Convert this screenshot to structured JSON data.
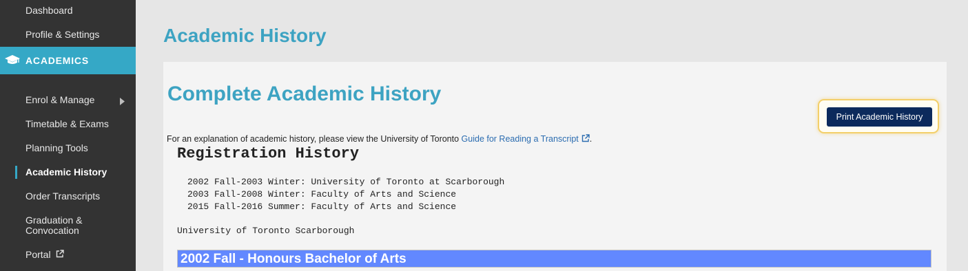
{
  "sidebar": {
    "items_top": [
      {
        "label": "Dashboard"
      },
      {
        "label": "Profile & Settings"
      }
    ],
    "section": {
      "label": "ACADEMICS",
      "icon": "graduation-cap-icon"
    },
    "items": [
      {
        "label": "Enrol & Manage",
        "icon": "chevron-right-icon"
      },
      {
        "label": "Timetable & Exams"
      },
      {
        "label": "Planning Tools"
      },
      {
        "label": "Academic History",
        "active": true
      },
      {
        "label": "Order Transcripts"
      },
      {
        "label": "Graduation &"
      },
      {
        "label": "Convocation"
      },
      {
        "label": "Portal",
        "icon": "external-link-icon"
      }
    ]
  },
  "main": {
    "title": "Academic History",
    "panel": {
      "title": "Complete Academic History",
      "print_button": "Print Academic History",
      "intro_text": "For an explanation of academic history, please view the University of Toronto ",
      "intro_link": "Guide for Reading a Transcript",
      "intro_end": ".",
      "registration": {
        "title": "Registration History",
        "lines": [
          "2002 Fall-2003 Winter: University of Toronto at Scarborough",
          "2003 Fall-2008 Winter: Faculty of Arts and Science",
          "2015 Fall-2016 Summer: Faculty of Arts and Science"
        ]
      },
      "institution": "University of Toronto Scarborough",
      "term_heading": "2002 Fall - Honours Bachelor of Arts"
    }
  },
  "colors": {
    "sidebar_bg": "#333333",
    "accent": "#35a8c6",
    "title": "#3da3c2",
    "button_bg": "#0c2a5c",
    "term_bar": "#6288ff"
  }
}
